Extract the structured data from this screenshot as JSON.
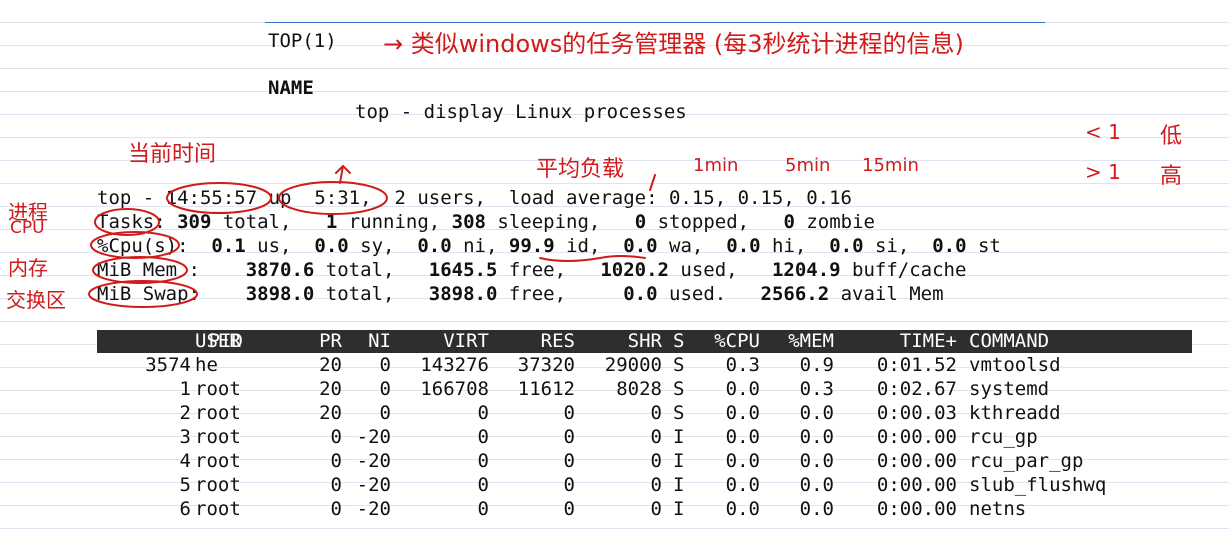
{
  "man": {
    "title": "TOP(1)",
    "section_name": "NAME",
    "description": "top - display Linux processes"
  },
  "summary": {
    "line1": {
      "prefix": "top - ",
      "time": "14:55:57",
      "uptime": "up  5:31,",
      "rest": "  2 users,  load average: 0.15, 0.15, 0.16"
    },
    "tasks": {
      "label": "Tasks:",
      "total": "309",
      "total_l": " total,   ",
      "running": "1",
      "running_l": " running, ",
      "sleeping": "308",
      "sleeping_l": " sleeping,   ",
      "stopped": "0",
      "stopped_l": " stopped,   ",
      "zombie": "0",
      "zombie_l": " zombie"
    },
    "cpu": {
      "label": "%Cpu(s):",
      "us": "0.1",
      "us_l": " us,  ",
      "sy": "0.0",
      "sy_l": " sy,  ",
      "ni": "0.0",
      "ni_l": " ni, ",
      "id": "99.9",
      "id_l": " id,  ",
      "wa": "0.0",
      "wa_l": " wa,  ",
      "hi": "0.0",
      "hi_l": " hi,  ",
      "si": "0.0",
      "si_l": " si,  ",
      "st": "0.0",
      "st_l": " st"
    },
    "mem": {
      "label": "MiB Mem :",
      "total": "3870.6",
      "total_l": " total,   ",
      "free": "1645.5",
      "free_l": " free,   ",
      "used": "1020.2",
      "used_l": " used,   ",
      "cache": "1204.9",
      "cache_l": " buff/cache"
    },
    "swap": {
      "label": "MiB Swap:",
      "total": "3898.0",
      "total_l": " total,   ",
      "free": "3898.0",
      "free_l": " free,     ",
      "used": "0.0",
      "used_l": " used.   ",
      "avail": "2566.2",
      "avail_l": " avail Mem"
    }
  },
  "columns": [
    "PID",
    "USER",
    "PR",
    "NI",
    "VIRT",
    "RES",
    "SHR",
    "S",
    "%CPU",
    "%MEM",
    "TIME+",
    "COMMAND"
  ],
  "processes": [
    [
      "3574",
      "he",
      "20",
      "0",
      "143276",
      "37320",
      "29000",
      "S",
      "0.3",
      "0.9",
      "0:01.52",
      "vmtoolsd"
    ],
    [
      "1",
      "root",
      "20",
      "0",
      "166708",
      "11612",
      "8028",
      "S",
      "0.0",
      "0.3",
      "0:02.67",
      "systemd"
    ],
    [
      "2",
      "root",
      "20",
      "0",
      "0",
      "0",
      "0",
      "S",
      "0.0",
      "0.0",
      "0:00.03",
      "kthreadd"
    ],
    [
      "3",
      "root",
      "0",
      "-20",
      "0",
      "0",
      "0",
      "I",
      "0.0",
      "0.0",
      "0:00.00",
      "rcu_gp"
    ],
    [
      "4",
      "root",
      "0",
      "-20",
      "0",
      "0",
      "0",
      "I",
      "0.0",
      "0.0",
      "0:00.00",
      "rcu_par_gp"
    ],
    [
      "5",
      "root",
      "0",
      "-20",
      "0",
      "0",
      "0",
      "I",
      "0.0",
      "0.0",
      "0:00.00",
      "slub_flushwq"
    ],
    [
      "6",
      "root",
      "0",
      "-20",
      "0",
      "0",
      "0",
      "I",
      "0.0",
      "0.0",
      "0:00.00",
      "netns"
    ]
  ],
  "annotations": {
    "title_note": "→ 类似windows的任务管理器 (每3秒统计进程的信息)",
    "current_time": "当前时间",
    "load_avg": "平均负载",
    "min1": "1min",
    "min5": "5min",
    "min15": "15min",
    "lt1": "< 1",
    "low": "低",
    "gt1": "> 1",
    "high": "高",
    "process": "进程",
    "cpu": "CPU",
    "memory": "内存",
    "swap": "交换区"
  },
  "colors": {
    "ink": "#d11a1a",
    "header_bg": "#2e2e2e",
    "rule": "#3b6fd0"
  }
}
